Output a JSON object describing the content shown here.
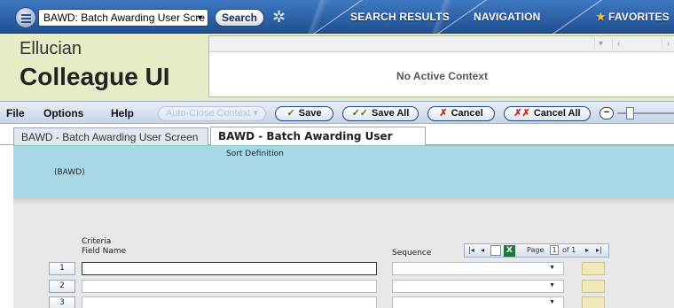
{
  "topbar": {
    "form_select_value": "BAWD: Batch Awarding User Scre",
    "search_label": "Search",
    "nav_search_results": "SEARCH RESULTS",
    "nav_navigation": "NAVIGATION",
    "nav_favorites": "FAVORITES"
  },
  "header": {
    "brand_line1": "Ellucian",
    "brand_line2": "Colleague UI",
    "context_text": "No Active Context"
  },
  "toolbar": {
    "menu_file": "File",
    "menu_options": "Options",
    "menu_help": "Help",
    "auto_close": "Auto-Close Context",
    "save": "Save",
    "save_all": "Save All",
    "cancel": "Cancel",
    "cancel_all": "Cancel All"
  },
  "tabs": [
    {
      "label": "BAWD - Batch Awarding User Screen",
      "active": false
    },
    {
      "label": "BAWD - Batch Awarding User Screen",
      "active": true
    }
  ],
  "form": {
    "sort_definition": "Sort Definition",
    "form_code": "(BAWD)",
    "criteria_label": "Criteria",
    "field_name_label": "Field Name",
    "sequence_label": "Sequence",
    "pager": {
      "page_label": "Page",
      "page_value": "1",
      "of_label": "of 1"
    },
    "rows": [
      {
        "num": "1"
      },
      {
        "num": "2"
      },
      {
        "num": "3"
      }
    ]
  },
  "colors": {
    "topbar_blue": "#2f62a8",
    "header_bg": "#e7ecc6",
    "panel_blue": "#a8d8e6",
    "swatch": "#f1e8b8"
  }
}
